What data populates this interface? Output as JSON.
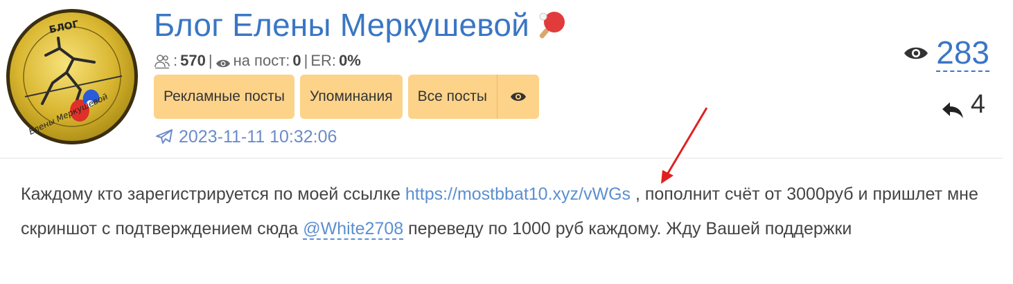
{
  "channel": {
    "title": "Блог Елены Меркушевой",
    "title_emoji": "🏓"
  },
  "stats": {
    "subscribers_icon": "subscribers-icon",
    "subscribers": "570",
    "per_post_label": "на пост:",
    "per_post": "0",
    "er_label": "ER:",
    "er": "0%"
  },
  "tags": {
    "ads": "Рекламные посты",
    "mentions": "Упоминания",
    "all": "Все посты"
  },
  "date": "2023-11-11 10:32:06",
  "counters": {
    "views": "283",
    "shares": "4"
  },
  "post": {
    "text1": "Каждому кто зарегистрируется по моей ссылке ",
    "link": "https://mostbbat10.xyz/vWGs",
    "text2": " , пополнит счёт от 3000руб и пришлет мне скриншот с подтверждением сюда ",
    "mention": "@White2708",
    "text3": " переведу по 1000 руб каждому. Жду Вашей поддержки"
  },
  "colors": {
    "accent": "#3a76c4",
    "tag_bg": "#fdd38a",
    "annotation_arrow": "#e02020"
  }
}
